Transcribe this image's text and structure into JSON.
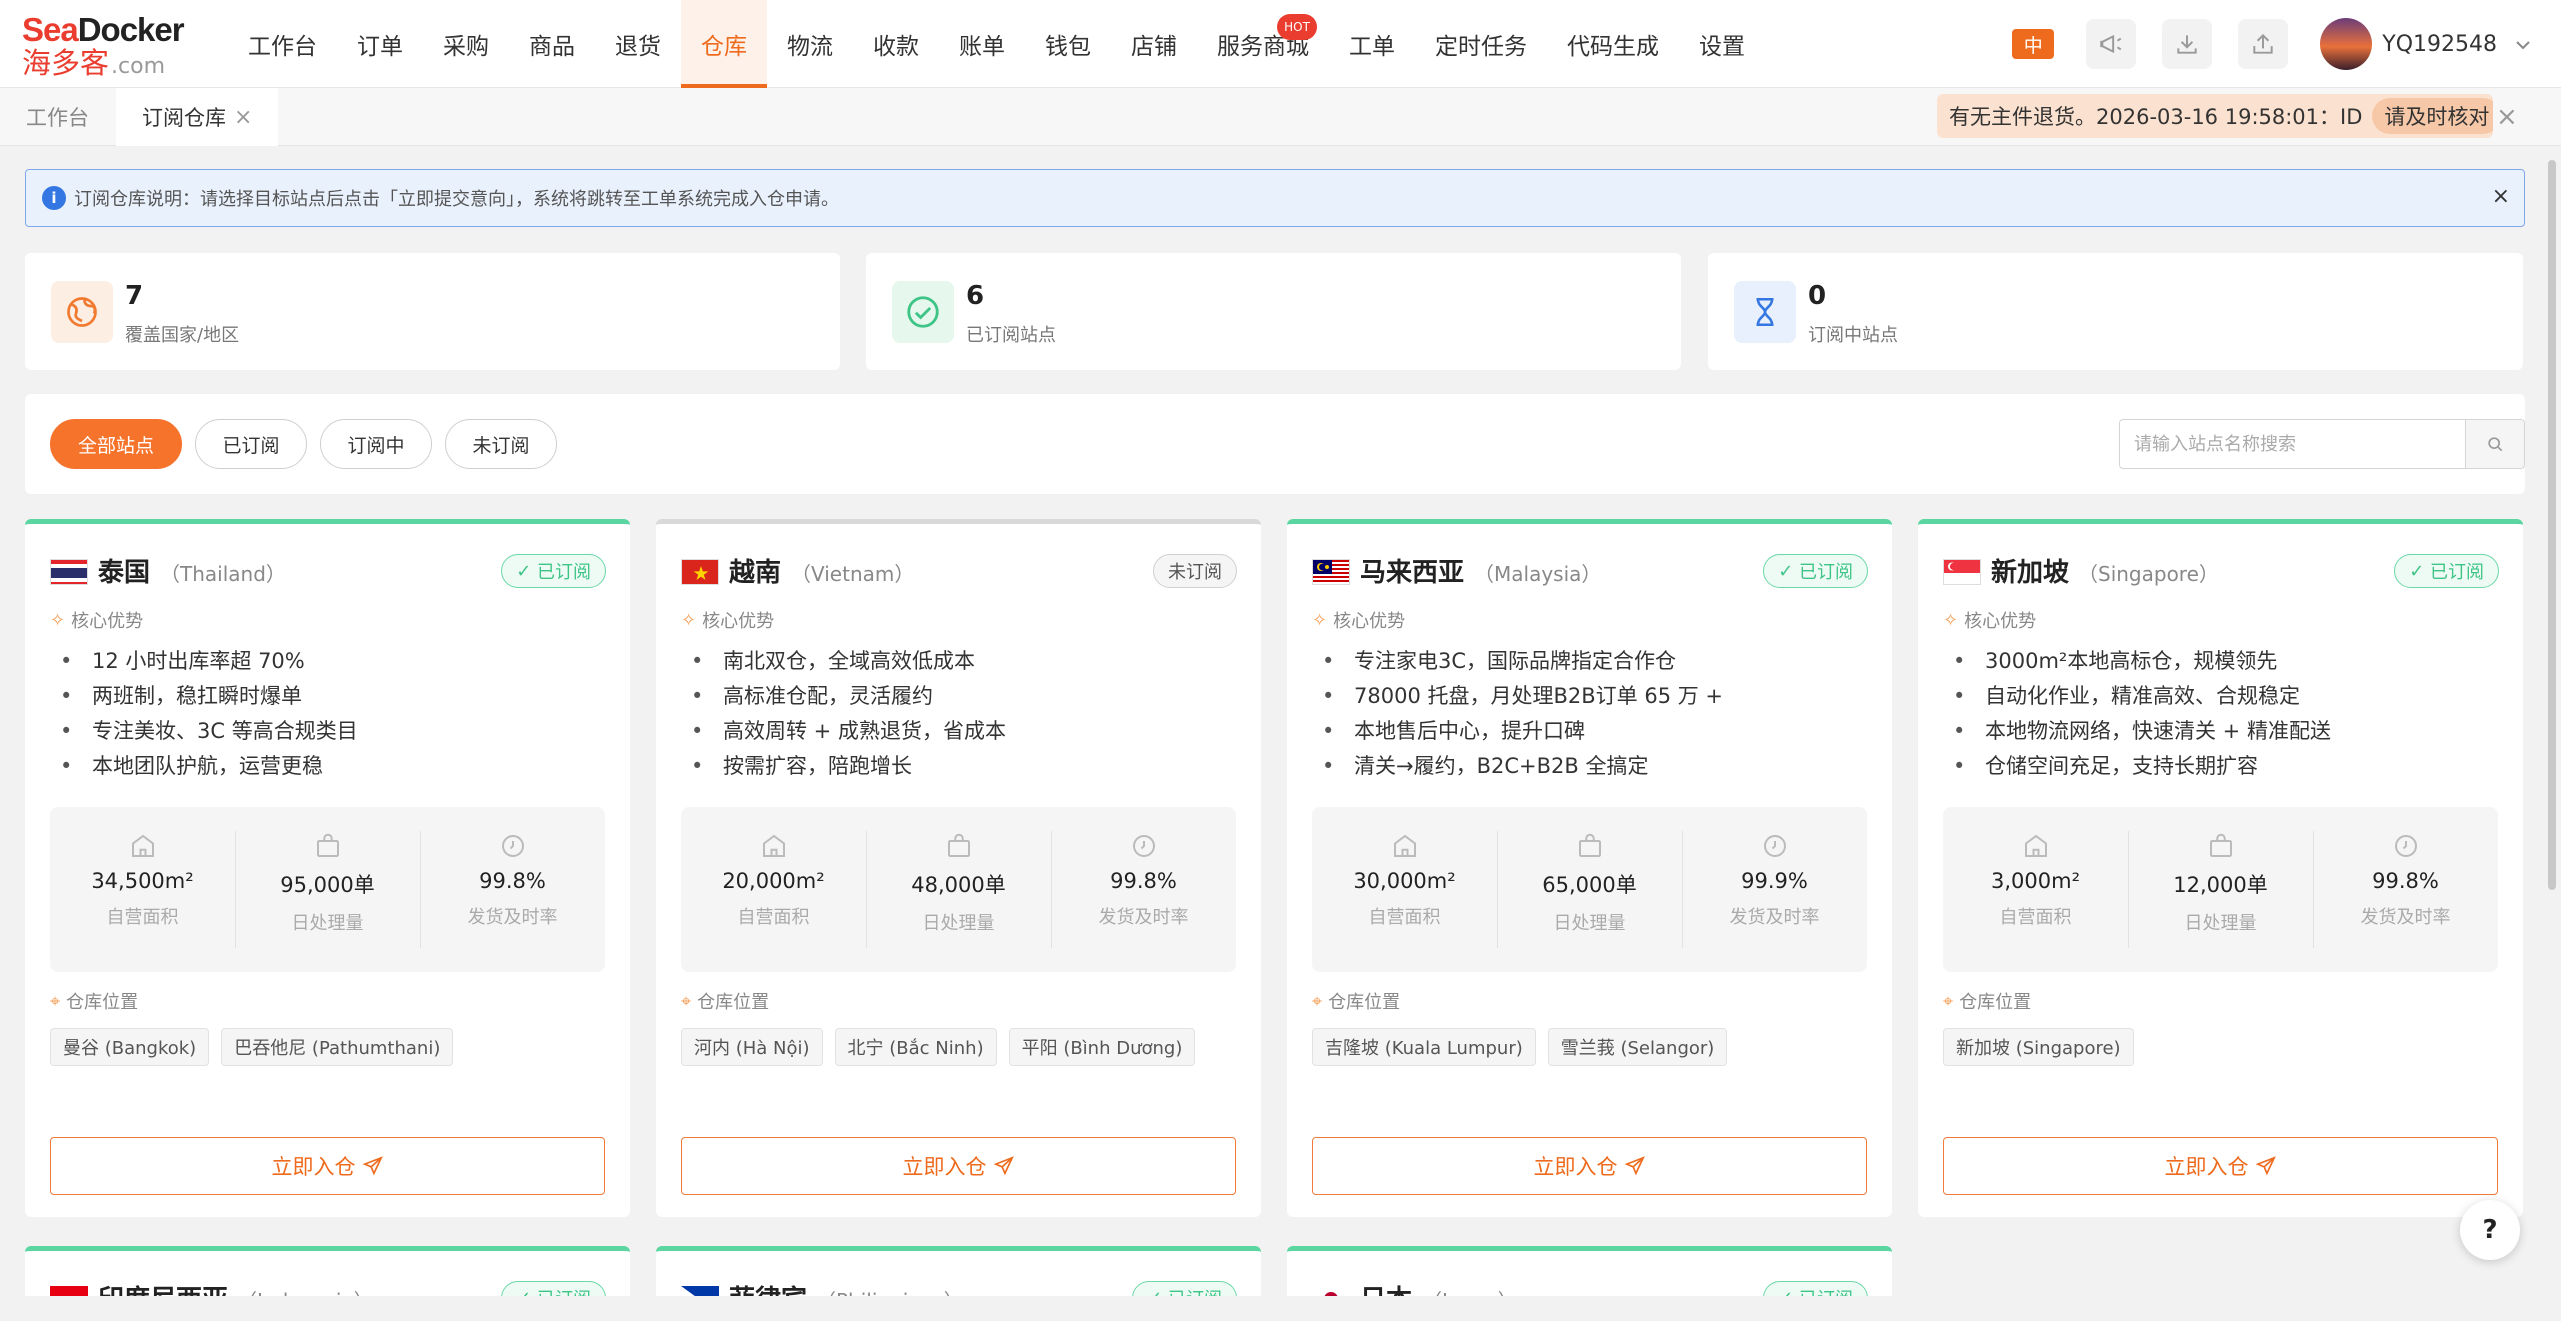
{
  "logo": {
    "en_a": "Sea",
    "en_b": "Docker",
    "cn": "海多客",
    "suffix": ".com"
  },
  "nav": [
    {
      "label": "工作台"
    },
    {
      "label": "订单"
    },
    {
      "label": "采购"
    },
    {
      "label": "商品"
    },
    {
      "label": "退货"
    },
    {
      "label": "仓库",
      "active": true
    },
    {
      "label": "物流"
    },
    {
      "label": "收款"
    },
    {
      "label": "账单"
    },
    {
      "label": "钱包"
    },
    {
      "label": "店铺"
    },
    {
      "label": "服务商城",
      "hot": "HOT"
    },
    {
      "label": "工单"
    },
    {
      "label": "定时任务"
    },
    {
      "label": "代码生成"
    },
    {
      "label": "设置"
    }
  ],
  "header": {
    "lang": "中",
    "username": "YQ192548"
  },
  "page_tabs": [
    {
      "label": "工作台"
    },
    {
      "label": "订阅仓库",
      "close": "×",
      "active": true
    }
  ],
  "notice": {
    "text": "有无主件退货。2026-03-16 19:58:01：ID",
    "action": "请及时核对",
    "close": "×"
  },
  "alert": {
    "icon": "i",
    "text": "订阅仓库说明：请选择目标站点后点击「立即提交意向」，系统将跳转至工单系统完成入仓申请。",
    "close": "×"
  },
  "stats": [
    {
      "value": "7",
      "label": "覆盖国家/地区",
      "icon": "globe-icon",
      "color": "#f07a2f"
    },
    {
      "value": "6",
      "label": "已订阅站点",
      "icon": "check-circle-icon",
      "color": "#3ec487"
    },
    {
      "value": "0",
      "label": "订阅中站点",
      "icon": "hourglass-icon",
      "color": "#3477e2"
    }
  ],
  "filters": [
    "全部站点",
    "已订阅",
    "订阅中",
    "未订阅"
  ],
  "search": {
    "placeholder": "请输入站点名称搜索"
  },
  "labels": {
    "advantages": "核心优势",
    "location": "仓库位置",
    "area": "自营面积",
    "daily": "日处理量",
    "ontime": "发货及时率",
    "subscribed": "已订阅",
    "unsubscribed": "未订阅",
    "enter": "立即入仓"
  },
  "cards": [
    {
      "cn": "泰国",
      "en": "（Thailand）",
      "status": "subscribed",
      "advantages": [
        "12 小时出库率超 70%",
        "两班制，稳扛瞬时爆单",
        "专注美妆、3C 等高合规类目",
        "本地团队护航，运营更稳"
      ],
      "area": "34,500m²",
      "daily": "95,000单",
      "ontime": "99.8%",
      "locations": [
        "曼谷 (Bangkok)",
        "巴吞他尼 (Pathumthani)"
      ]
    },
    {
      "cn": "越南",
      "en": "（Vietnam）",
      "status": "unsubscribed",
      "advantages": [
        "南北双仓，全域高效低成本",
        "高标准仓配，灵活履约",
        "高效周转 + 成熟退货，省成本",
        "按需扩容，陪跑增长"
      ],
      "area": "20,000m²",
      "daily": "48,000单",
      "ontime": "99.8%",
      "locations": [
        "河内 (Hà Nội)",
        "北宁 (Bắc Ninh)",
        "平阳 (Bình Dương)"
      ]
    },
    {
      "cn": "马来西亚",
      "en": "（Malaysia）",
      "status": "subscribed",
      "advantages": [
        "专注家电3C，国际品牌指定合作仓",
        "78000 托盘，月处理B2B订单 65 万 +",
        "本地售后中心，提升口碑",
        "清关→履约，B2C+B2B 全搞定"
      ],
      "area": "30,000m²",
      "daily": "65,000单",
      "ontime": "99.9%",
      "locations": [
        "吉隆坡 (Kuala Lumpur)",
        "雪兰莪 (Selangor)"
      ]
    },
    {
      "cn": "新加坡",
      "en": "（Singapore）",
      "status": "subscribed",
      "advantages": [
        "3000m²本地高标仓，规模领先",
        "自动化作业，精准高效、合规稳定",
        "本地物流网络，快速清关 + 精准配送",
        "仓储空间充足，支持长期扩容"
      ],
      "area": "3,000m²",
      "daily": "12,000单",
      "ontime": "99.8%",
      "locations": [
        "新加坡 (Singapore)"
      ]
    }
  ],
  "cards_row2": [
    {
      "cn": "印度尼西亚",
      "en": "（Indonesia）",
      "status": "subscribed"
    },
    {
      "cn": "菲律宾",
      "en": "（Philippines）",
      "status": "subscribed"
    },
    {
      "cn": "日本",
      "en": "（Japan）",
      "status": "subscribed"
    }
  ],
  "help": "?"
}
